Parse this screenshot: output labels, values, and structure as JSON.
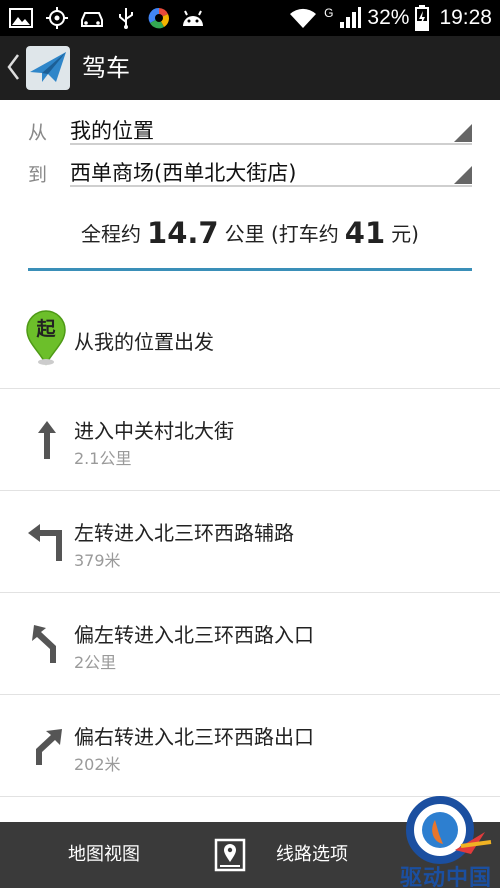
{
  "status_bar": {
    "network_letter": "G",
    "battery": "32%",
    "time": "19:28"
  },
  "action_bar": {
    "title": "驾车"
  },
  "route_form": {
    "from_label": "从",
    "from_value": "我的位置",
    "to_label": "到",
    "to_value": "西单商场(西单北大街店)"
  },
  "summary": {
    "prefix": "全程约",
    "distance": "14.7",
    "unit_text": "公里 (打车约",
    "fare": "41",
    "suffix": "元)"
  },
  "steps": [
    {
      "icon": "start-marker-icon",
      "marker_text": "起",
      "title": "从我的位置出发",
      "distance": ""
    },
    {
      "icon": "arrow-straight-icon",
      "title": "进入中关村北大街",
      "distance": "2.1公里"
    },
    {
      "icon": "arrow-turn-left-icon",
      "title": "左转进入北三环西路辅路",
      "distance": "379米"
    },
    {
      "icon": "arrow-slight-left-icon",
      "title": "偏左转进入北三环西路入口",
      "distance": "2公里"
    },
    {
      "icon": "arrow-slight-right-icon",
      "title": "偏右转进入北三环西路出口",
      "distance": "202米"
    }
  ],
  "bottom_bar": {
    "map_view_label": "地图视图",
    "route_options_label": "线路选项"
  },
  "watermark": {
    "text": "驱动中国"
  }
}
